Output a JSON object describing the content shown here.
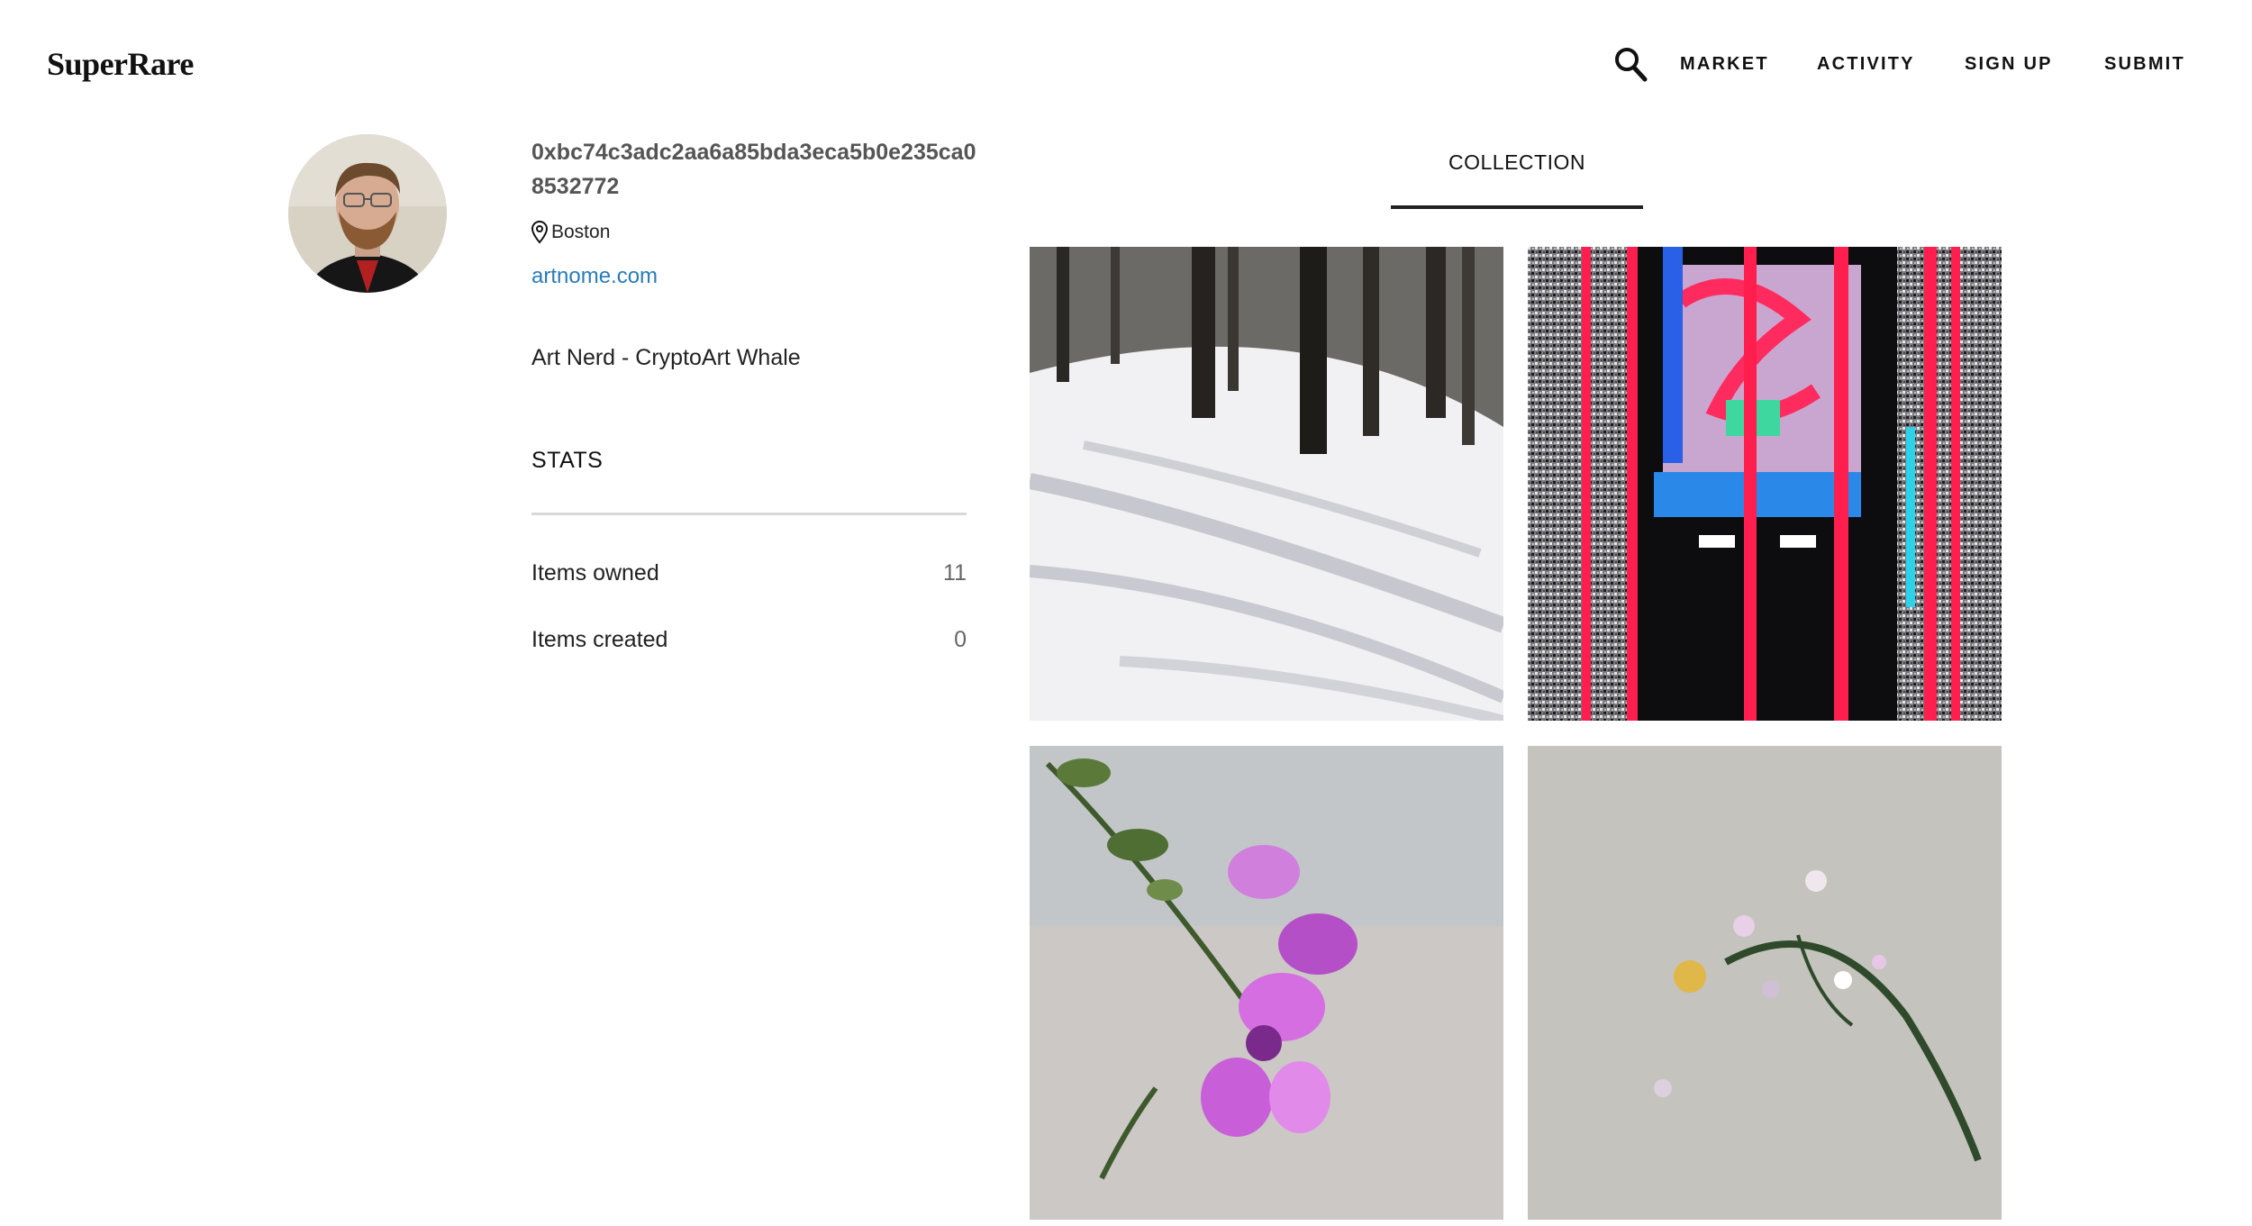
{
  "header": {
    "logo": "SuperRare",
    "nav": [
      "MARKET",
      "ACTIVITY",
      "SIGN UP",
      "SUBMIT"
    ]
  },
  "profile": {
    "address": "0xbc74c3adc2aa6a85bda3eca5b0e235ca08532772",
    "location": "Boston",
    "website": "artnome.com",
    "bio": "Art Nerd - CryptoArt Whale"
  },
  "stats": {
    "heading": "STATS",
    "rows": [
      {
        "label": "Items owned",
        "value": "11"
      },
      {
        "label": "Items created",
        "value": "0"
      }
    ]
  },
  "tabs": [
    "COLLECTION"
  ],
  "colors": {
    "link": "#2a7ab8",
    "text": "#1c1c1c",
    "muted": "#555555"
  }
}
